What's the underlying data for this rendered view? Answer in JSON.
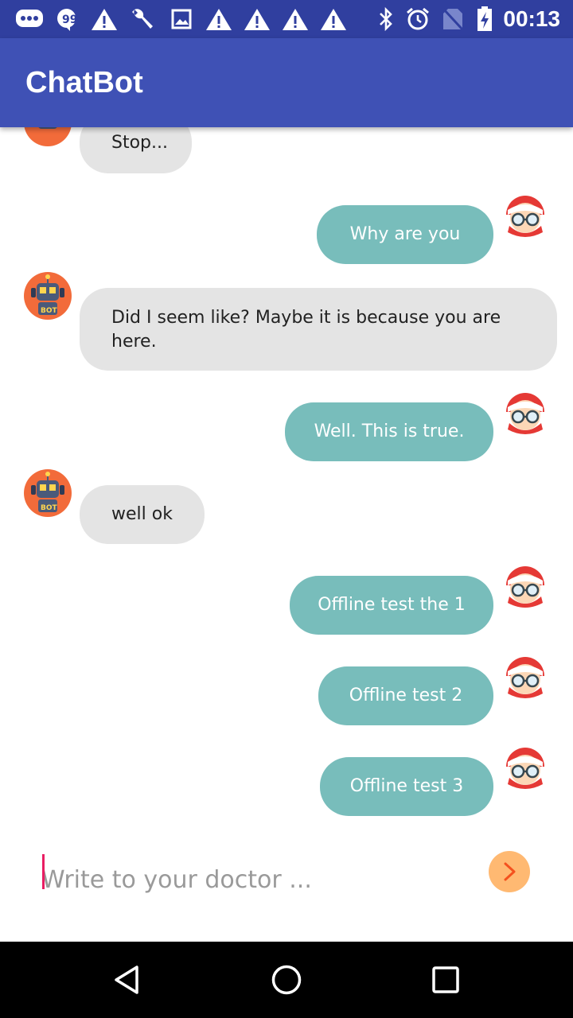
{
  "status_bar": {
    "time": "00:13",
    "left_icons": [
      "messages-icon",
      "quote-icon",
      "warning-icon",
      "wrench-icon",
      "image-icon",
      "warning-icon",
      "warning-icon",
      "warning-icon",
      "warning-icon"
    ],
    "right_icons": [
      "bluetooth-icon",
      "alarm-icon",
      "no-sim-icon",
      "battery-charging-icon"
    ]
  },
  "app_bar": {
    "title": "ChatBot"
  },
  "colors": {
    "primary": "#3f51b5",
    "primary_dark": "#303f9f",
    "user_bubble": "#78bdbb",
    "bot_bubble": "#e4e4e4",
    "send_button": "#ffb972",
    "accent": "#e91e63"
  },
  "messages": [
    {
      "sender": "bot",
      "text": "Stop..."
    },
    {
      "sender": "user",
      "text": "Why are you"
    },
    {
      "sender": "bot",
      "text": "Did I seem like? Maybe it is because you are here."
    },
    {
      "sender": "user",
      "text": "Well. This is true."
    },
    {
      "sender": "bot",
      "text": "well ok"
    },
    {
      "sender": "user",
      "text": "Offline test the 1"
    },
    {
      "sender": "user",
      "text": "Offline test 2"
    },
    {
      "sender": "user",
      "text": "Offline test 3"
    }
  ],
  "input": {
    "placeholder": "Write to your doctor ...",
    "value": ""
  },
  "navigation": {
    "buttons": [
      "back-icon",
      "home-icon",
      "recents-icon"
    ]
  }
}
